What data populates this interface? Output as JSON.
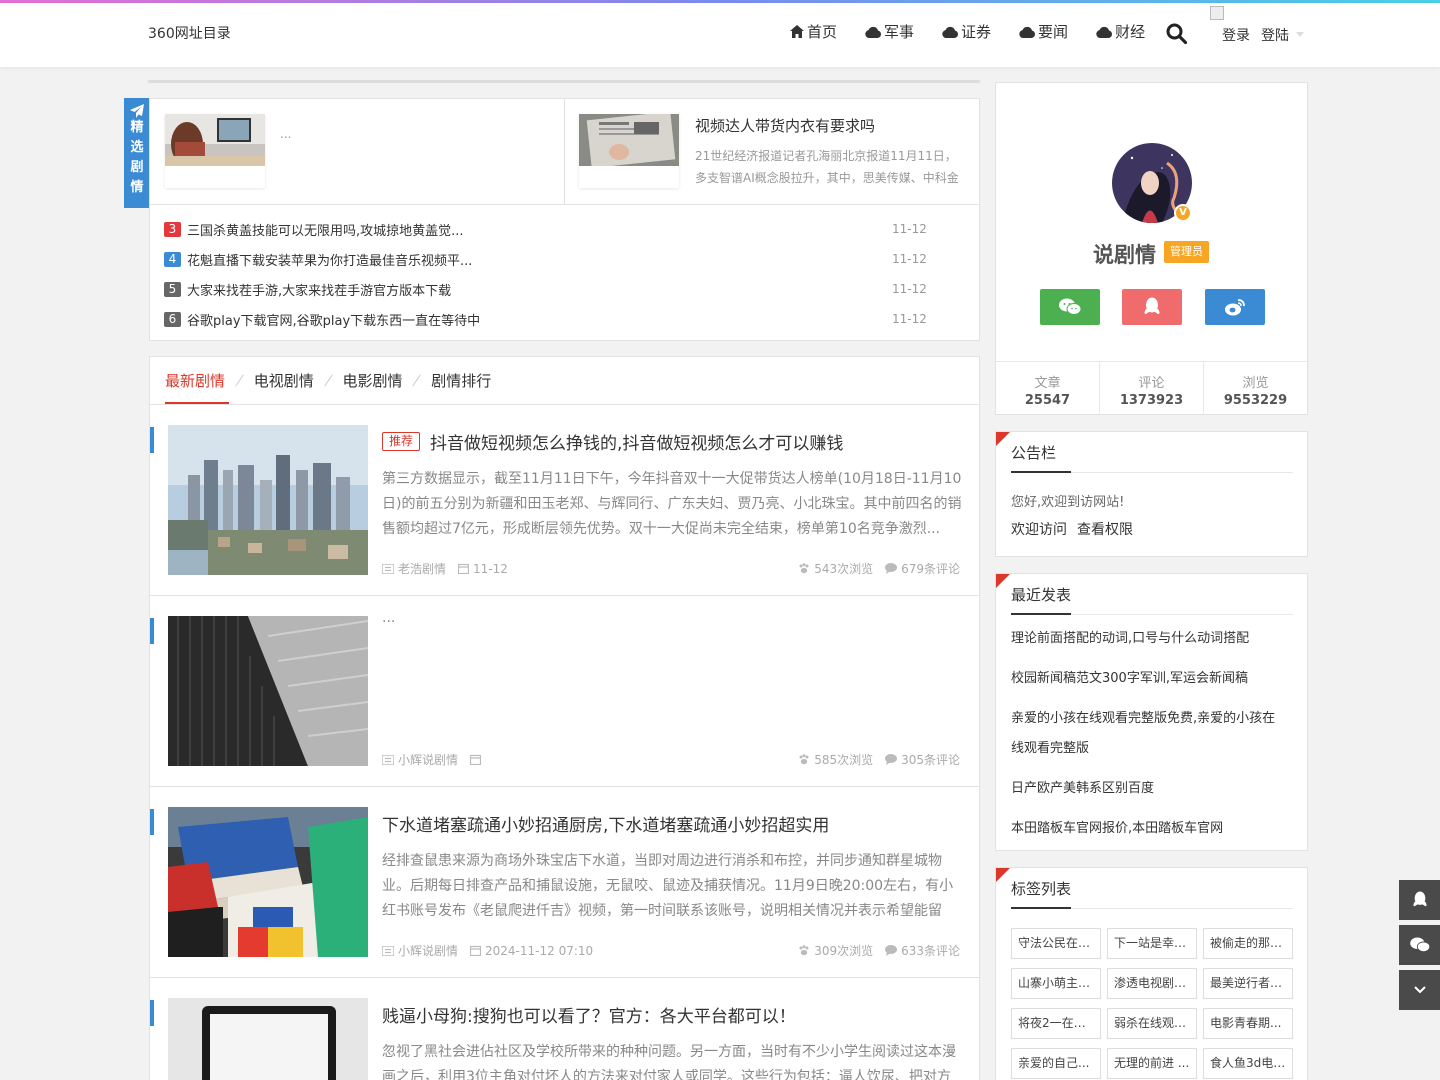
{
  "header": {
    "logo_text": "360网址目录",
    "nav": [
      {
        "icon": "home-icon",
        "label": "首页"
      },
      {
        "icon": "cloud-icon",
        "label": "军事"
      },
      {
        "icon": "cloud-icon",
        "label": "证券"
      },
      {
        "icon": "cloud-icon",
        "label": "要闻"
      },
      {
        "icon": "cloud-icon",
        "label": "财经"
      }
    ],
    "login_label": "登录",
    "register_label": "登陆"
  },
  "featured": {
    "side_label": [
      "精",
      "选",
      "剧",
      "情"
    ],
    "card1_text": "...",
    "card2_title": "视频达人带货内衣有要求吗",
    "card2_desc": "21世纪经济报道记者孔海丽北京报道11月11日，多支智谱AI概念股拉升，其中，思美传媒、中科金",
    "list": [
      {
        "num": "3",
        "title": "三国杀黄盖技能可以无限用吗,攻城掠地黄盖觉...",
        "date": "11-12",
        "color": "#e4393c"
      },
      {
        "num": "4",
        "title": "花魁直播下载安装苹果为你打造最佳音乐视频平...",
        "date": "11-12",
        "color": "#3a8ad4"
      },
      {
        "num": "5",
        "title": "大家来找茬手游,大家来找茬手游官方版本下载",
        "date": "11-12",
        "color": "#666666"
      },
      {
        "num": "6",
        "title": "谷歌play下载官网,谷歌play下载东西一直在等待中",
        "date": "11-12",
        "color": "#666666"
      }
    ]
  },
  "tabs": [
    "最新剧情",
    "电视剧情",
    "电影剧情",
    "剧情排行"
  ],
  "posts": [
    {
      "badge": "推荐",
      "title": "抖音做短视频怎么挣钱的,抖音做短视频怎么才可以赚钱",
      "excerpt": "第三方数据显示，截至11月11日下午，今年抖音双十一大促带货达人榜单(10月18日-11月10日)的前五分别为新疆和田玉老郑、与辉同行、广东夫妇、贾乃亮、小北珠宝。其中前四名的销售额均超过7亿元，形成断层领先优势。双十一大促尚未完全结束，榜单第10名竞争激烈...",
      "author": "老浩剧情",
      "date": "11-12",
      "views": "543次浏览",
      "comments": "679条评论"
    },
    {
      "badge": "",
      "title": "",
      "excerpt": "...",
      "author": "小辉说剧情",
      "date": "",
      "views": "585次浏览",
      "comments": "305条评论"
    },
    {
      "badge": "",
      "title": "下水道堵塞疏通小妙招通厨房,下水道堵塞疏通小妙招超实用",
      "excerpt": "经排查鼠患来源为商场外珠宝店下水道，当即对周边进行消杀和布控，并同步通知群星城物业。后期每日排查产品和捕鼠设施，无鼠咬、鼠迹及捕获情况。11月9日晚20:00左右，有小红书账号发布《老鼠爬进仟吉》视频，第一时间联系该账号，说明相关情况并表示希望能留下...",
      "author": "小辉说剧情",
      "date": "2024-11-12 07:10",
      "views": "309次浏览",
      "comments": "633条评论"
    },
    {
      "badge": "",
      "title": "贱逼小母狗:搜狗也可以看了？官方：各大平台都可以！",
      "excerpt": "忽视了黑社会进佔社区及学校所带来的种种问题。另一方面，当时有不少小学生阅读过这本漫画之后，利用3位主角对付坏人的方法来对付家人或同学。这些行为包括：逼人饮尿、把对方",
      "author": "",
      "date": "",
      "views": "",
      "comments": ""
    }
  ],
  "profile": {
    "name": "说剧情",
    "role": "管理员",
    "stats": [
      {
        "label": "文章",
        "value": "25547"
      },
      {
        "label": "评论",
        "value": "1373923"
      },
      {
        "label": "浏览",
        "value": "9553229"
      }
    ],
    "colors": {
      "wechat": "#4caf50",
      "qq": "#f06b6b",
      "weibo": "#3a8ad4"
    }
  },
  "notice": {
    "title": "公告栏",
    "text": "您好,欢迎到访网站!",
    "links": [
      "欢迎访问",
      "查看权限"
    ]
  },
  "recent": {
    "title": "最近发表",
    "items": [
      "理论前面搭配的动词,口号与什么动词搭配",
      "校园新闻稿范文300字军训,军运会新闻稿",
      "亲爱的小孩在线观看完整版免费,亲爱的小孩在线观看完整版",
      "日产欧产美韩系区别百度",
      "本田踏板车官网报价,本田踏板车官网"
    ]
  },
  "tags": {
    "title": "标签列表",
    "items": [
      "守法公民在线...",
      "下一站是幸福...",
      "被偷走的那五...",
      "山寨小萌主电...",
      "渗透电视剧全...",
      "最美逆行者电...",
      "将夜2一在线...",
      "弱杀在线观看...",
      "电影青春期...",
      "亲爱的自己...",
      "无理的前进 ...",
      "食人鱼3d电影..."
    ]
  }
}
